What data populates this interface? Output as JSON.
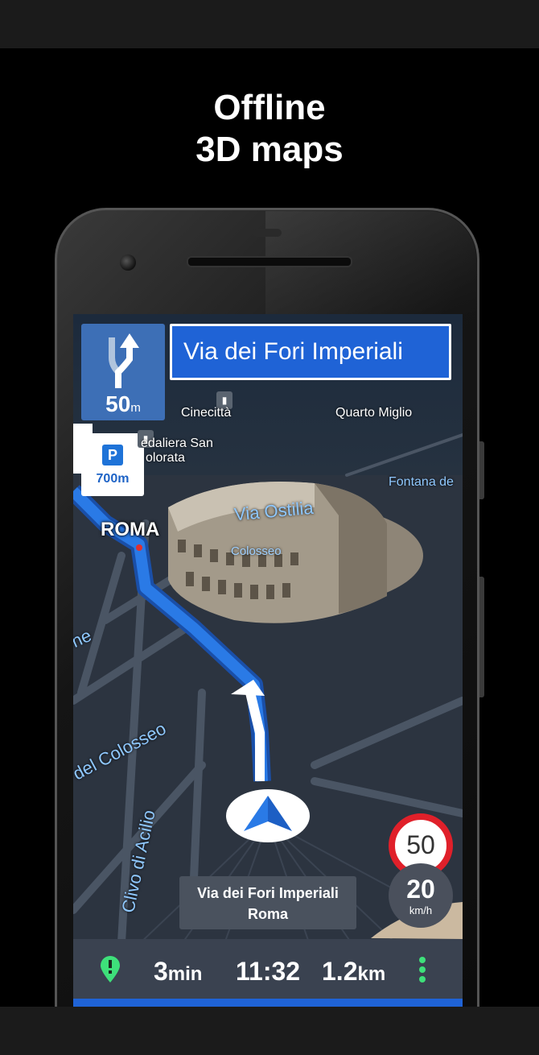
{
  "headline": {
    "line1": "Offline",
    "line2": "3D maps"
  },
  "navigation": {
    "next_turn": {
      "distance": "50",
      "unit": "m",
      "icon": "turn-right-fork-icon"
    },
    "next_street": "Via dei Fori Imperiali",
    "parking": {
      "icon": "parking-icon",
      "letter": "P",
      "distance": "700m"
    }
  },
  "map": {
    "labels": {
      "cinecitta": "Cinecittà",
      "quarto_miglio": "Quarto Miglio",
      "caffarella_1": "edaliera San",
      "caffarella_2": "olorata",
      "fontana": "Fontana de",
      "via_ostilia": "Via Ostilia",
      "colosseo": "Colosseo",
      "roma": "ROMA",
      "del_colosseo": "del Colosseo",
      "clivo": "Clivo di Acilio",
      "ne": "ne"
    }
  },
  "speed": {
    "limit": "50",
    "current": "20",
    "unit": "km/h"
  },
  "current_street": {
    "line1": "Via dei Fori Imperiali",
    "line2": "Roma"
  },
  "trip": {
    "remaining_time_value": "3",
    "remaining_time_unit": "min",
    "arrival_time": "11:32",
    "remaining_distance_value": "1.2",
    "remaining_distance_unit": "km"
  },
  "colors": {
    "route": "#1f63d6",
    "accent_green": "#3ee07a",
    "speed_limit_red": "#e0202a"
  }
}
